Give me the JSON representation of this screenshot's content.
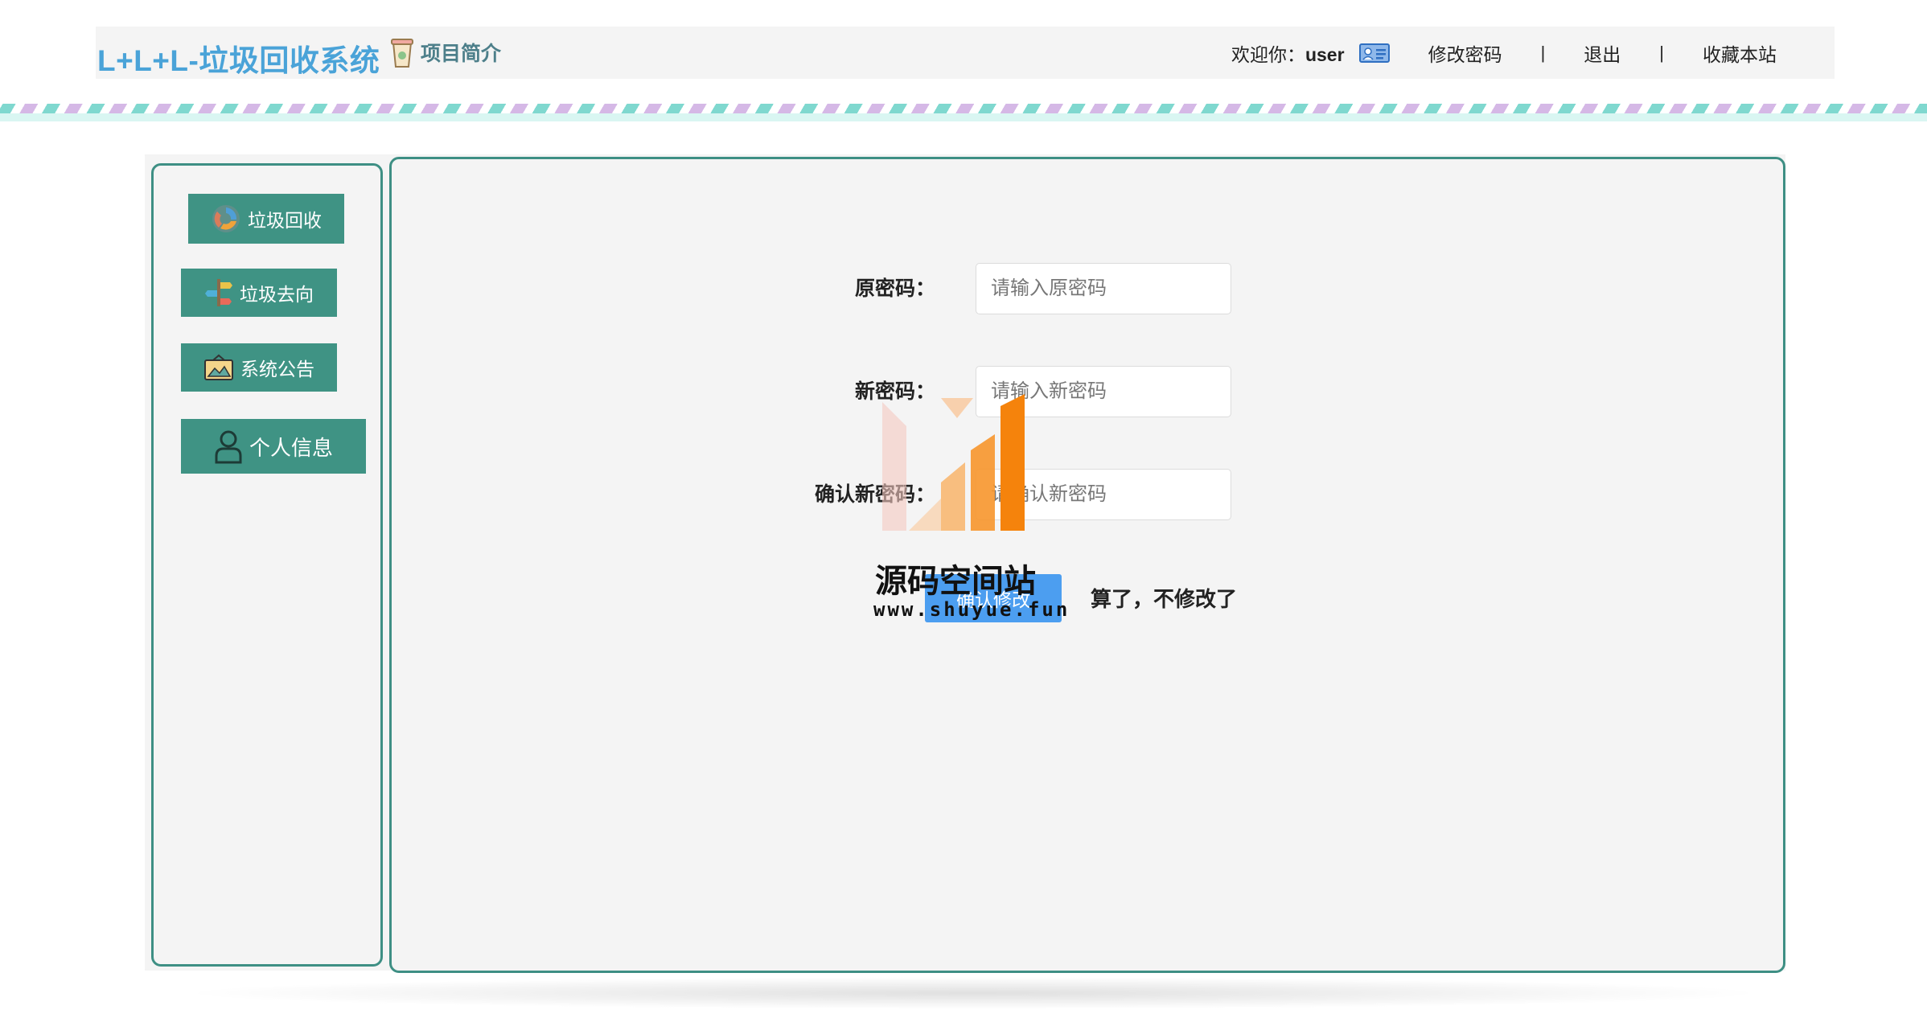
{
  "header": {
    "brand": "L+L+L-垃圾回收系统",
    "intro_label": "项目简介",
    "welcome_prefix": "欢迎你：",
    "username": "user",
    "nav": {
      "change_password": "修改密码",
      "separator": "|",
      "logout": "退出",
      "bookmark": "收藏本站"
    },
    "icons": {
      "intro": "cup-icon",
      "user": "id-card-icon"
    }
  },
  "sidebar": {
    "items": [
      {
        "label": "垃圾回收",
        "icon": "recycle-icon"
      },
      {
        "label": "垃圾去向",
        "icon": "signpost-icon"
      },
      {
        "label": "系统公告",
        "icon": "announcement-icon"
      },
      {
        "label": "个人信息",
        "icon": "person-icon"
      }
    ]
  },
  "form": {
    "old_password": {
      "label": "原密码：",
      "placeholder": "请输入原密码",
      "value": ""
    },
    "new_password": {
      "label": "新密码：",
      "placeholder": "请输入新密码",
      "value": ""
    },
    "confirm_password": {
      "label": "确认新密码：",
      "placeholder": "请确认新密码",
      "value": ""
    },
    "submit_label": "确认修改",
    "cancel_label": "算了，不修改了"
  },
  "watermark": {
    "title": "源码空间站",
    "url": "www.shuyue.fun"
  },
  "colors": {
    "brand": "#4aa3d8",
    "accent": "#3f9384",
    "button": "#4c9ef0",
    "panel": "#f4f4f4"
  }
}
